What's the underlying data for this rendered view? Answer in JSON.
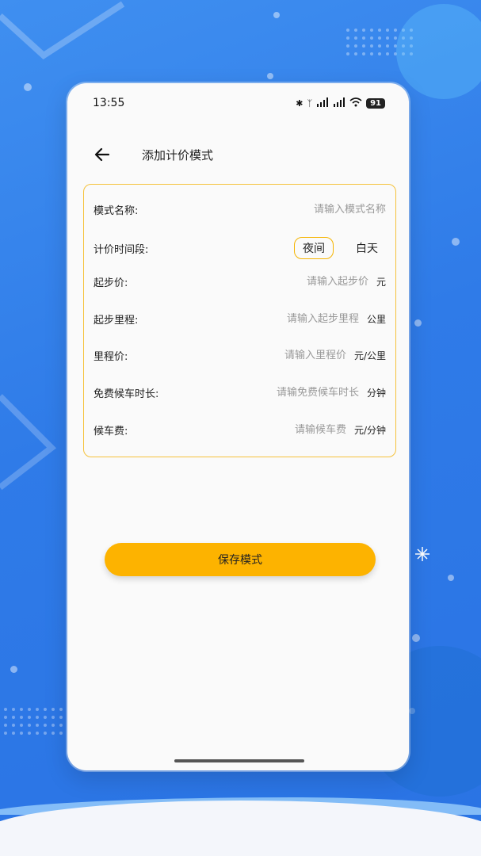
{
  "status_bar": {
    "time": "13:55",
    "battery": "91",
    "icons": [
      "bluetooth-icon",
      "nfc-icon",
      "signal-5g-icon",
      "signal-5g-icon",
      "wifi-icon"
    ]
  },
  "header": {
    "title": "添加计价模式"
  },
  "form": {
    "mode_name": {
      "label": "模式名称:",
      "placeholder": "请输入模式名称"
    },
    "period": {
      "label": "计价时间段:",
      "options": [
        "夜间",
        "白天"
      ],
      "selected": "夜间"
    },
    "start_price": {
      "label": "起步价:",
      "placeholder": "请输入起步价",
      "unit": "元"
    },
    "start_distance": {
      "label": "起步里程:",
      "placeholder": "请输入起步里程",
      "unit": "公里"
    },
    "mileage_price": {
      "label": "里程价:",
      "placeholder": "请输入里程价",
      "unit": "元/公里"
    },
    "free_wait": {
      "label": "免费候车时长:",
      "placeholder": "请输免费候车时长",
      "unit": "分钟"
    },
    "wait_fee": {
      "label": "候车费:",
      "placeholder": "请输候车费",
      "unit": "元/分钟"
    }
  },
  "save_button": "保存模式",
  "colors": {
    "accent": "#fdb300",
    "card_border": "#f5c23b",
    "background": "#2f7be8"
  }
}
